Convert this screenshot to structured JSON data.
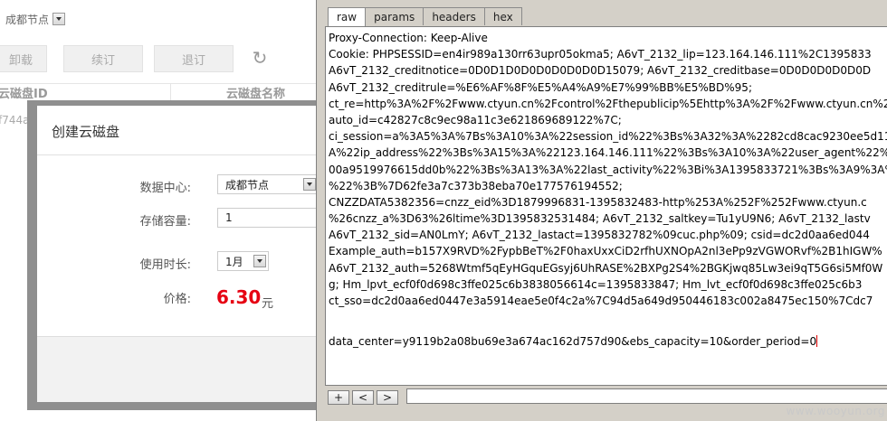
{
  "background_page": {
    "region_select": "成都节点",
    "buttons": [
      "卸载",
      "续订",
      "退订"
    ],
    "columns": [
      "云磁盘ID",
      "云磁盘名称"
    ],
    "row_id_fragment": "f744a"
  },
  "modal": {
    "title": "创建云磁盘",
    "data_center_label": "数据中心:",
    "data_center_value": "成都节点",
    "capacity_label": "存储容量:",
    "capacity_value": "1",
    "duration_label": "使用时长:",
    "duration_value": "1月",
    "price_label": "价格:",
    "price_value": "6.30",
    "price_unit": "元"
  },
  "editor": {
    "tabs": [
      "raw",
      "params",
      "headers",
      "hex"
    ],
    "active_tab": "raw",
    "lines": [
      "Proxy-Connection: Keep-Alive",
      "Cookie: PHPSESSID=en4ir989a130rr63upr05okma5; A6vT_2132_lip=123.164.146.111%2C1395833",
      "A6vT_2132_creditnotice=0D0D1D0D0D0D0D0D0D15079; A6vT_2132_creditbase=0D0D0D0D0D0D",
      "A6vT_2132_creditrule=%E6%AF%8F%E5%A4%A9%E7%99%BB%E5%BD%95;",
      "ct_re=http%3A%2F%2Fwww.ctyun.cn%2Fcontrol%2Fthepublicip%5Ehttp%3A%2F%2Fwww.ctyun.cn%2",
      "auto_id=c42827c8c9ec98a11c3e621869689122%7C;",
      "ci_session=a%3A5%3A%7Bs%3A10%3A%22session_id%22%3Bs%3A32%3A%2282cd8cac9230ee5d11",
      "A%22ip_address%22%3Bs%3A15%3A%22123.164.146.111%22%3Bs%3A10%3A%22user_agent%22%3",
      "00a9519976615dd0b%22%3Bs%3A13%3A%22last_activity%22%3Bi%3A1395833721%3Bs%3A9%3A%",
      "%22%3B%7D62fe3a7c373b38eba70e177576194552;",
      "CNZZDATA5382356=cnzz_eid%3D1879996831-1395832483-http%253A%252F%252Fwww.ctyun.c",
      "%26cnzz_a%3D63%26ltime%3D1395832531484; A6vT_2132_saltkey=Tu1yU9N6; A6vT_2132_lastv",
      "A6vT_2132_sid=AN0LmY; A6vT_2132_lastact=1395832782%09cuc.php%09; csid=dc2d0aa6ed044",
      "Example_auth=b157X9RVD%2FypbBeT%2F0haxUxxCiD2rfhUXNOpA2nl3ePp9zVGWORvf%2B1hIGW%",
      "A6vT_2132_auth=5268Wtmf5qEyHGquEGsyj6UhRASE%2BXPg2S4%2BGKjwq85Lw3ei9qT5G6si5Mf0W",
      "g; Hm_lpvt_ecf0f0d698c3ffe025c6b3838056614c=1395833847; Hm_lvt_ecf0f0d698c3ffe025c6b3",
      "ct_sso=dc2d0aa6ed0447e3a5914eae5e0f4c2a%7C94d5a649d950446183c002a8475ec150%7Cdc7"
    ],
    "body_line": "data_center=y9119b2a08bu69e3a674ac162d757d90&ebs_capacity=10&order_period=0",
    "nav_buttons": [
      "+",
      "<",
      ">"
    ],
    "watermark": "www.wooyun.org"
  }
}
